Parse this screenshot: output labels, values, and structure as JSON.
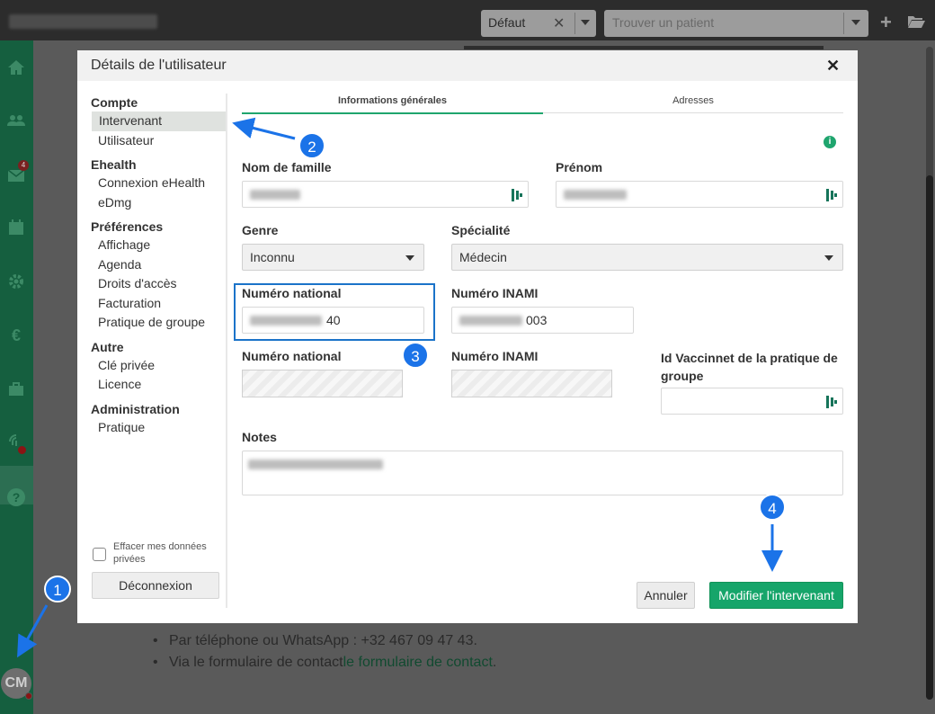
{
  "topbar": {
    "profile_select": "Défaut",
    "clear_symbol": "✕",
    "patient_search_placeholder": "Trouver un patient",
    "add_symbol": "+"
  },
  "sidebar": {
    "mail_badge": "4",
    "avatar_initials": "CM",
    "help_symbol": "?",
    "euro_symbol": "€"
  },
  "background_page": {
    "contact_phone": "Par téléphone ou WhatsApp : +32 467 09 47 43.",
    "contact_form_prefix": "Via le formulaire de contact",
    "contact_form_link": "le formulaire de contact",
    "contact_form_suffix": "."
  },
  "modal": {
    "title": "Détails de l'utilisateur",
    "close_symbol": "✕",
    "nav": [
      {
        "section": "Compte",
        "items": [
          "Intervenant",
          "Utilisateur"
        ]
      },
      {
        "section": "Ehealth",
        "items": [
          "Connexion eHealth",
          "eDmg"
        ]
      },
      {
        "section": "Préférences",
        "items": [
          "Affichage",
          "Agenda",
          "Droits d'accès",
          "Facturation",
          "Pratique de groupe"
        ]
      },
      {
        "section": "Autre",
        "items": [
          "Clé privée",
          "Licence"
        ]
      },
      {
        "section": "Administration",
        "items": [
          "Pratique"
        ]
      }
    ],
    "active_nav_item": "Intervenant",
    "privacy_checkbox_label": "Effacer mes données privées",
    "logout_label": "Déconnexion",
    "tabs": [
      "Informations générales",
      "Adresses"
    ],
    "active_tab": "Informations générales",
    "info_symbol": "i",
    "form": {
      "last_name_label": "Nom de famille",
      "first_name_label": "Prénom",
      "gender_label": "Genre",
      "gender_value": "Inconnu",
      "specialty_label": "Spécialité",
      "specialty_value": "Médecin",
      "national_number_label": "Numéro national",
      "national_number_suffix": "40",
      "inami_label": "Numéro INAMI",
      "inami_suffix": "003",
      "national_number_label_2": "Numéro national",
      "inami_label_2": "Numéro INAMI",
      "vaccinnet_label": "Id Vaccinnet de la pratique de groupe",
      "notes_label": "Notes"
    },
    "cancel_label": "Annuler",
    "submit_label": "Modifier l'intervenant"
  },
  "annotations": [
    "1",
    "2",
    "3",
    "4"
  ],
  "colors": {
    "accent_green": "#16a56a",
    "sidebar_green": "#155f3f",
    "annotation_blue": "#1b73e8"
  }
}
